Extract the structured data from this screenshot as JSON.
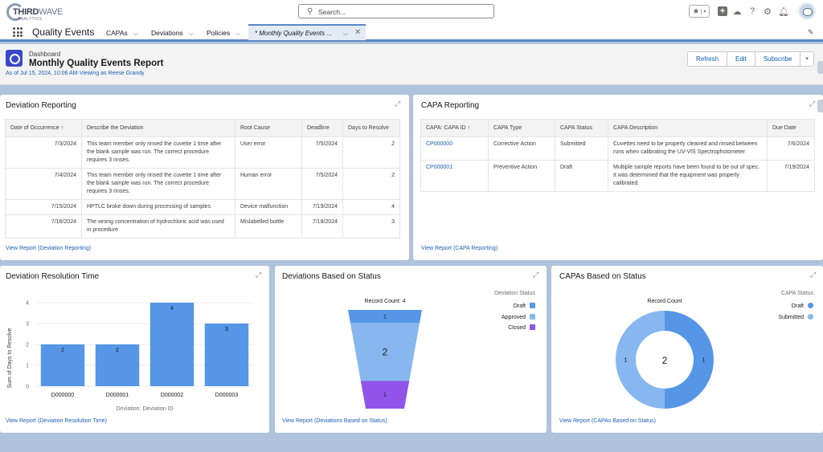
{
  "brand": {
    "logo_main": "THIRD",
    "logo_accent": "WAVE",
    "logo_sub": "ANALYTICS"
  },
  "search": {
    "placeholder": "Search..."
  },
  "utility_icons": [
    "favorites-star-icon",
    "add-icon",
    "trailhead-icon",
    "help-icon",
    "setup-gear-icon",
    "notifications-bell-icon",
    "avatar"
  ],
  "nav": {
    "app_name": "Quality Events",
    "items": [
      {
        "label": "CAPAs"
      },
      {
        "label": "Deviations"
      },
      {
        "label": "Policies"
      }
    ],
    "active_tab": "* Monthly Quality Events ..."
  },
  "header": {
    "type": "Dashboard",
    "title": "Monthly Quality Events Report",
    "subtitle": "As of Jul 15, 2024, 10:06 AM·Viewing as Reese Grandy",
    "buttons": {
      "refresh": "Refresh",
      "edit": "Edit",
      "subscribe": "Subscribe",
      "more": "▾"
    }
  },
  "deviation_reporting": {
    "title": "Deviation Reporting",
    "columns": [
      "Date of Occurrence ↑",
      "Describe the Deviation",
      "Root Cause",
      "Deadline",
      "Days to Resolve"
    ],
    "rows": [
      [
        "7/3/2024",
        "This team member only rinsed the cuvette 1 time after the blank sample was run. The correct procedure requires 3 rinses.",
        "User error",
        "7/5/2024",
        "2"
      ],
      [
        "7/4/2024",
        "This team member only rinsed the cuvette 1 time after the blank sample was run. The correct procedure requires 3 rinses.",
        "Human error",
        "7/5/2024",
        "2"
      ],
      [
        "7/15/2024",
        "HPTLC broke down during processing of samples",
        "Device malfunction",
        "7/19/2024",
        "4"
      ],
      [
        "7/16/2024",
        "The wrong concentration of hydrochloric acid was used in procedure",
        "Mislabelled bottle",
        "7/18/2024",
        "3"
      ]
    ],
    "view_report": "View Report (Deviation Reporting)"
  },
  "capa_reporting": {
    "title": "CAPA Reporting",
    "columns": [
      "CAPA: CAPA ID ↑",
      "CAPA Type",
      "CAPA Status",
      "CAPA Description",
      "Due Date"
    ],
    "rows": [
      [
        "CP000000",
        "Corrective Action",
        "Submitted",
        "Cuvettes need to be properly cleaned and rinsed between runs when calibrating the UV-VIS Spectrophotometer",
        "7/6/2024"
      ],
      [
        "CP000001",
        "Preventive Action",
        "Draft",
        "Multiple sample reports have been found to be out of spec. It was determined that the equipment was properly calibrated.",
        "7/19/2024"
      ]
    ],
    "view_report": "View Report (CAPA Reporting)"
  },
  "chart_data": [
    {
      "type": "bar",
      "title": "Deviation Resolution Time",
      "categories": [
        "D000000",
        "D000001",
        "D000002",
        "D000003"
      ],
      "values": [
        2,
        2,
        4,
        3
      ],
      "xlabel": "Deviation: Deviation ID",
      "ylabel": "Sum of Days to Resolve",
      "ylim": [
        0,
        4
      ],
      "yticks": [
        "0",
        "1",
        "2",
        "3",
        "4"
      ],
      "color": "#5596e6",
      "grid": true,
      "view_report": "View Report (Deviation Resolution Time)"
    },
    {
      "type": "funnel",
      "title": "Deviations Based on Status",
      "subtitle": "Record Count: 4",
      "categories": [
        "Draft",
        "Approved",
        "Closed"
      ],
      "values": [
        1,
        2,
        1
      ],
      "colors": [
        "#5596e6",
        "#87b7ee",
        "#9153e8"
      ],
      "legend_title": "Deviation Status",
      "legend": "top-right",
      "view_report": "View Report (Deviations Based on Status)"
    },
    {
      "type": "pie",
      "variant": "donut",
      "title": "CAPAs Based on Status",
      "subtitle": "Record Count",
      "categories": [
        "Draft",
        "Submitted"
      ],
      "values": [
        1,
        1
      ],
      "total": "2",
      "colors": [
        "#5596e6",
        "#87b7ee"
      ],
      "legend_title": "CAPA Status",
      "legend": "top-right",
      "view_report": "View Report (CAPAs Based on Status)"
    }
  ]
}
